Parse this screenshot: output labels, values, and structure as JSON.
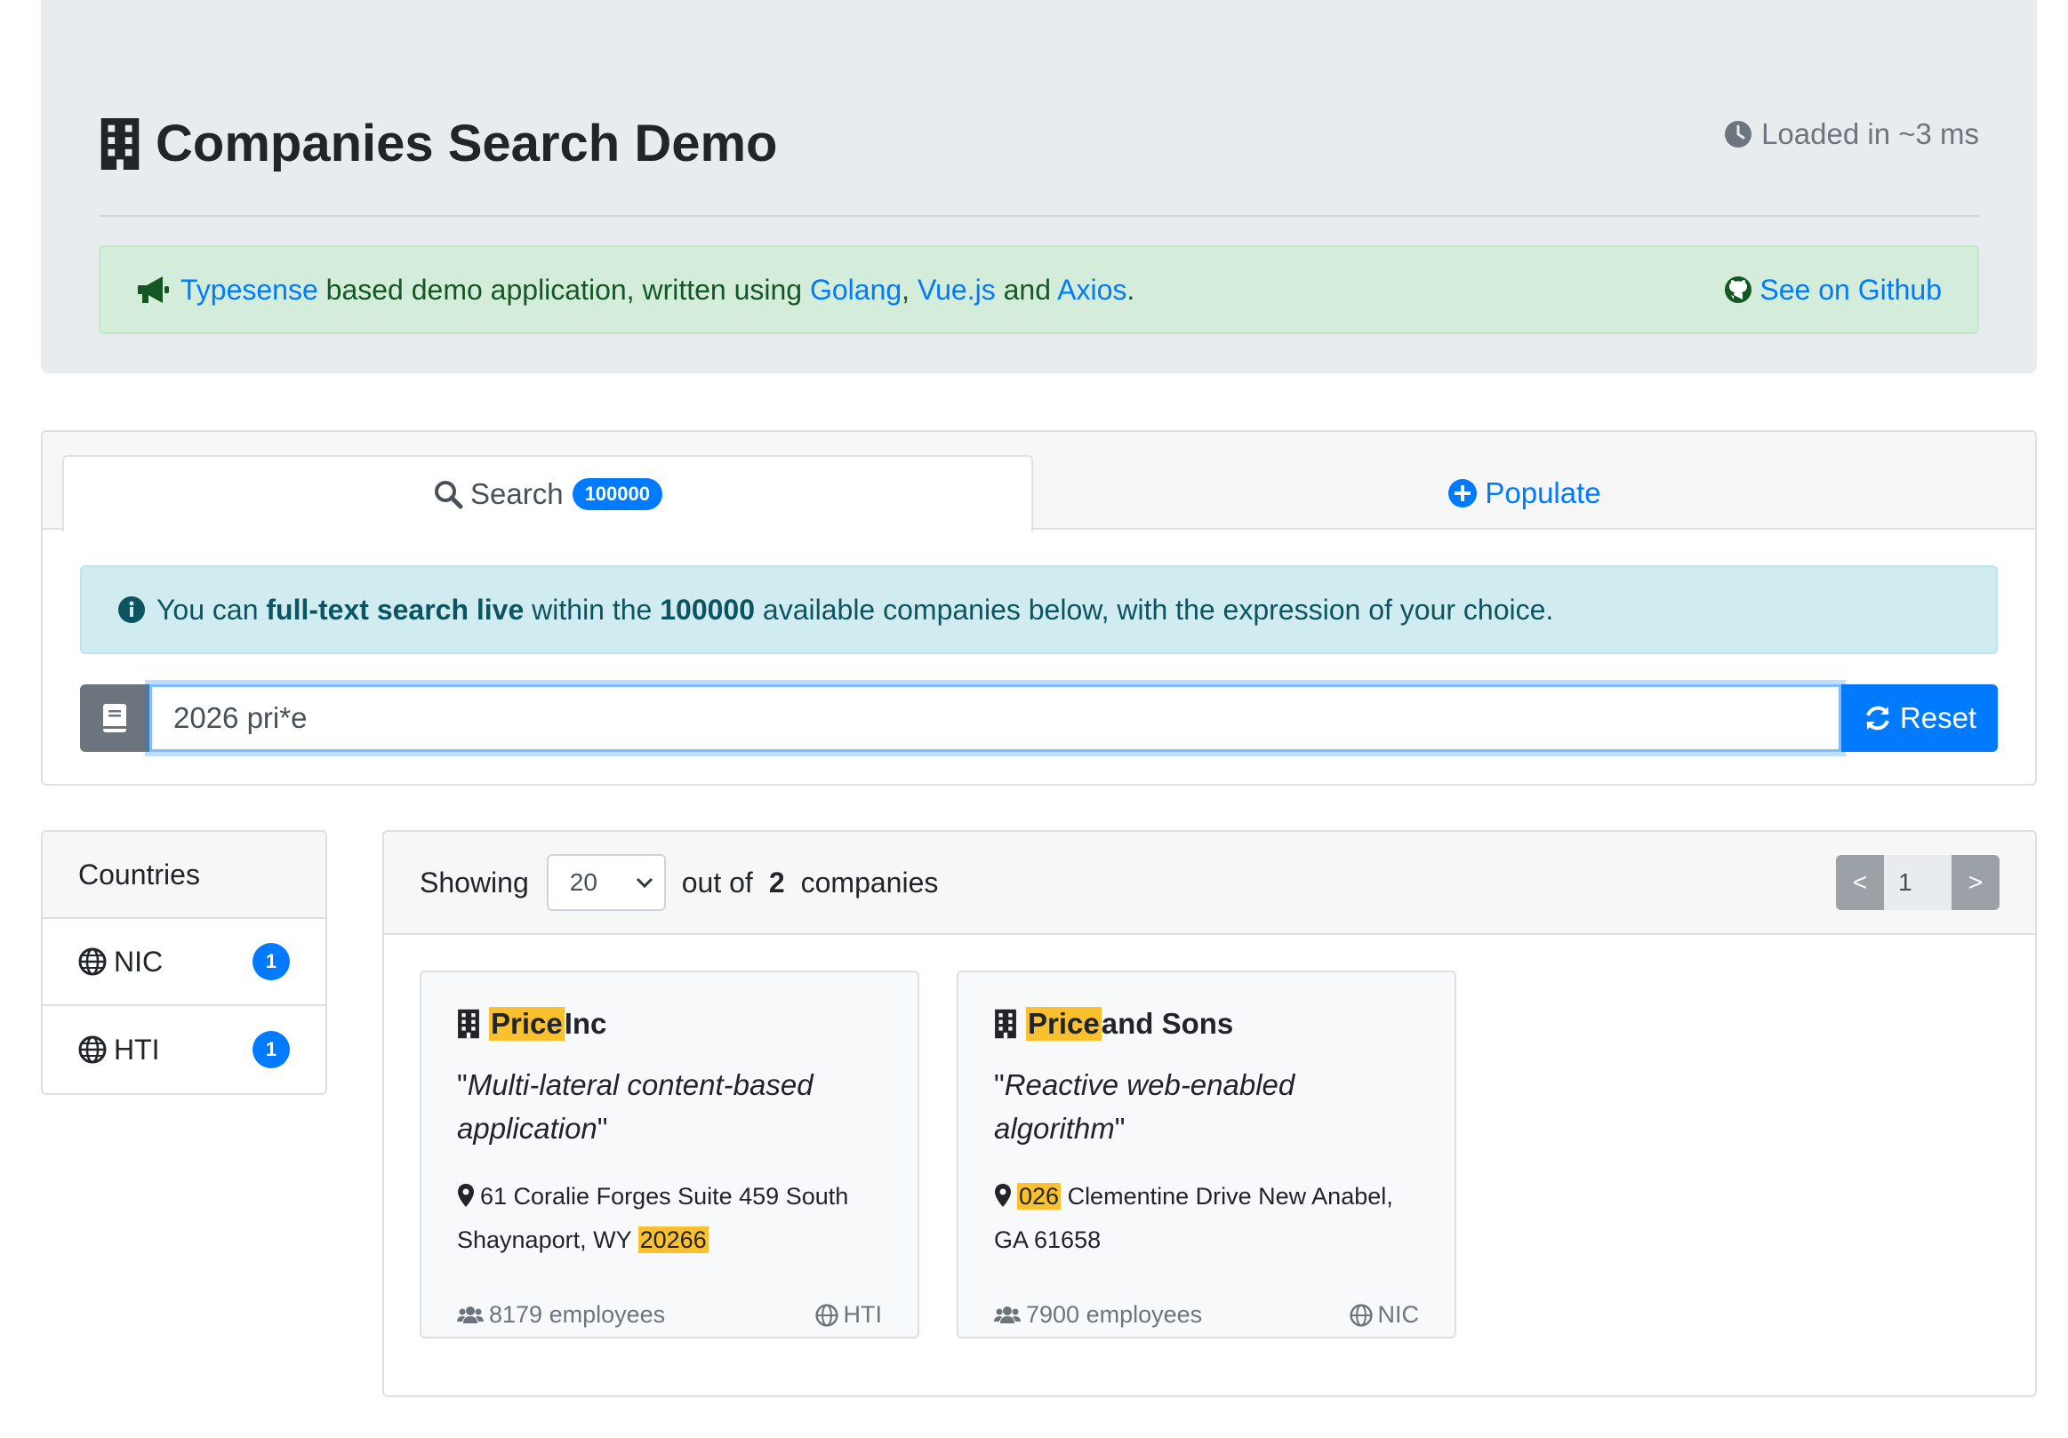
{
  "header": {
    "title": "Companies Search Demo",
    "loaded_text": "Loaded in ~3 ms"
  },
  "banner": {
    "link_typesense": "Typesense",
    "text_1": " based demo application, written using ",
    "link_golang": "Golang",
    "sep_comma": ", ",
    "link_vue": "Vue.js",
    "text_and": " and ",
    "link_axios": "Axios",
    "text_period": ".",
    "github_link": "See on Github"
  },
  "tabs": {
    "search_label": "Search",
    "search_count": "100000",
    "populate_label": "Populate"
  },
  "info": {
    "t1": "You can ",
    "b1": "full-text search live",
    "t2": " within the ",
    "b2": "100000",
    "t3": " available companies below, with the expression of your choice."
  },
  "search": {
    "value": "2026 pri*e",
    "reset_label": "Reset"
  },
  "countries": {
    "header": "Countries",
    "items": [
      {
        "name": "NIC",
        "count": "1"
      },
      {
        "name": "HTI",
        "count": "1"
      }
    ]
  },
  "results": {
    "showing_label": "Showing",
    "per_page": "20",
    "out_of_label": "out of",
    "total": "2",
    "companies_label": "companies",
    "prev": "<",
    "page": "1",
    "next": ">"
  },
  "cards": [
    {
      "name_highlight": "Price",
      "name_rest": " Inc",
      "quote_open": "\"",
      "catch_phrase": "Multi-lateral content-based application",
      "quote_close": "\"",
      "address_pre": "61 Coralie Forges Suite 459 South Shaynaport, WY ",
      "address_highlight": "20266",
      "address_post": "",
      "employees": "8179 employees",
      "country": "HTI"
    },
    {
      "name_highlight": "Price",
      "name_rest": " and Sons",
      "quote_open": "\"",
      "catch_phrase": "Reactive web-enabled algorithm",
      "quote_close": "\"",
      "address_pre": "",
      "address_highlight": "026",
      "address_post": " Clementine Drive New Anabel, GA 61658",
      "employees": "7900 employees",
      "country": "NIC"
    }
  ],
  "colors": {
    "primary": "#007bff",
    "highlight": "#fbc02d",
    "success_bg": "#d4edda",
    "info_bg": "#d1ecf1",
    "jumbotron_bg": "#e9ecef"
  }
}
